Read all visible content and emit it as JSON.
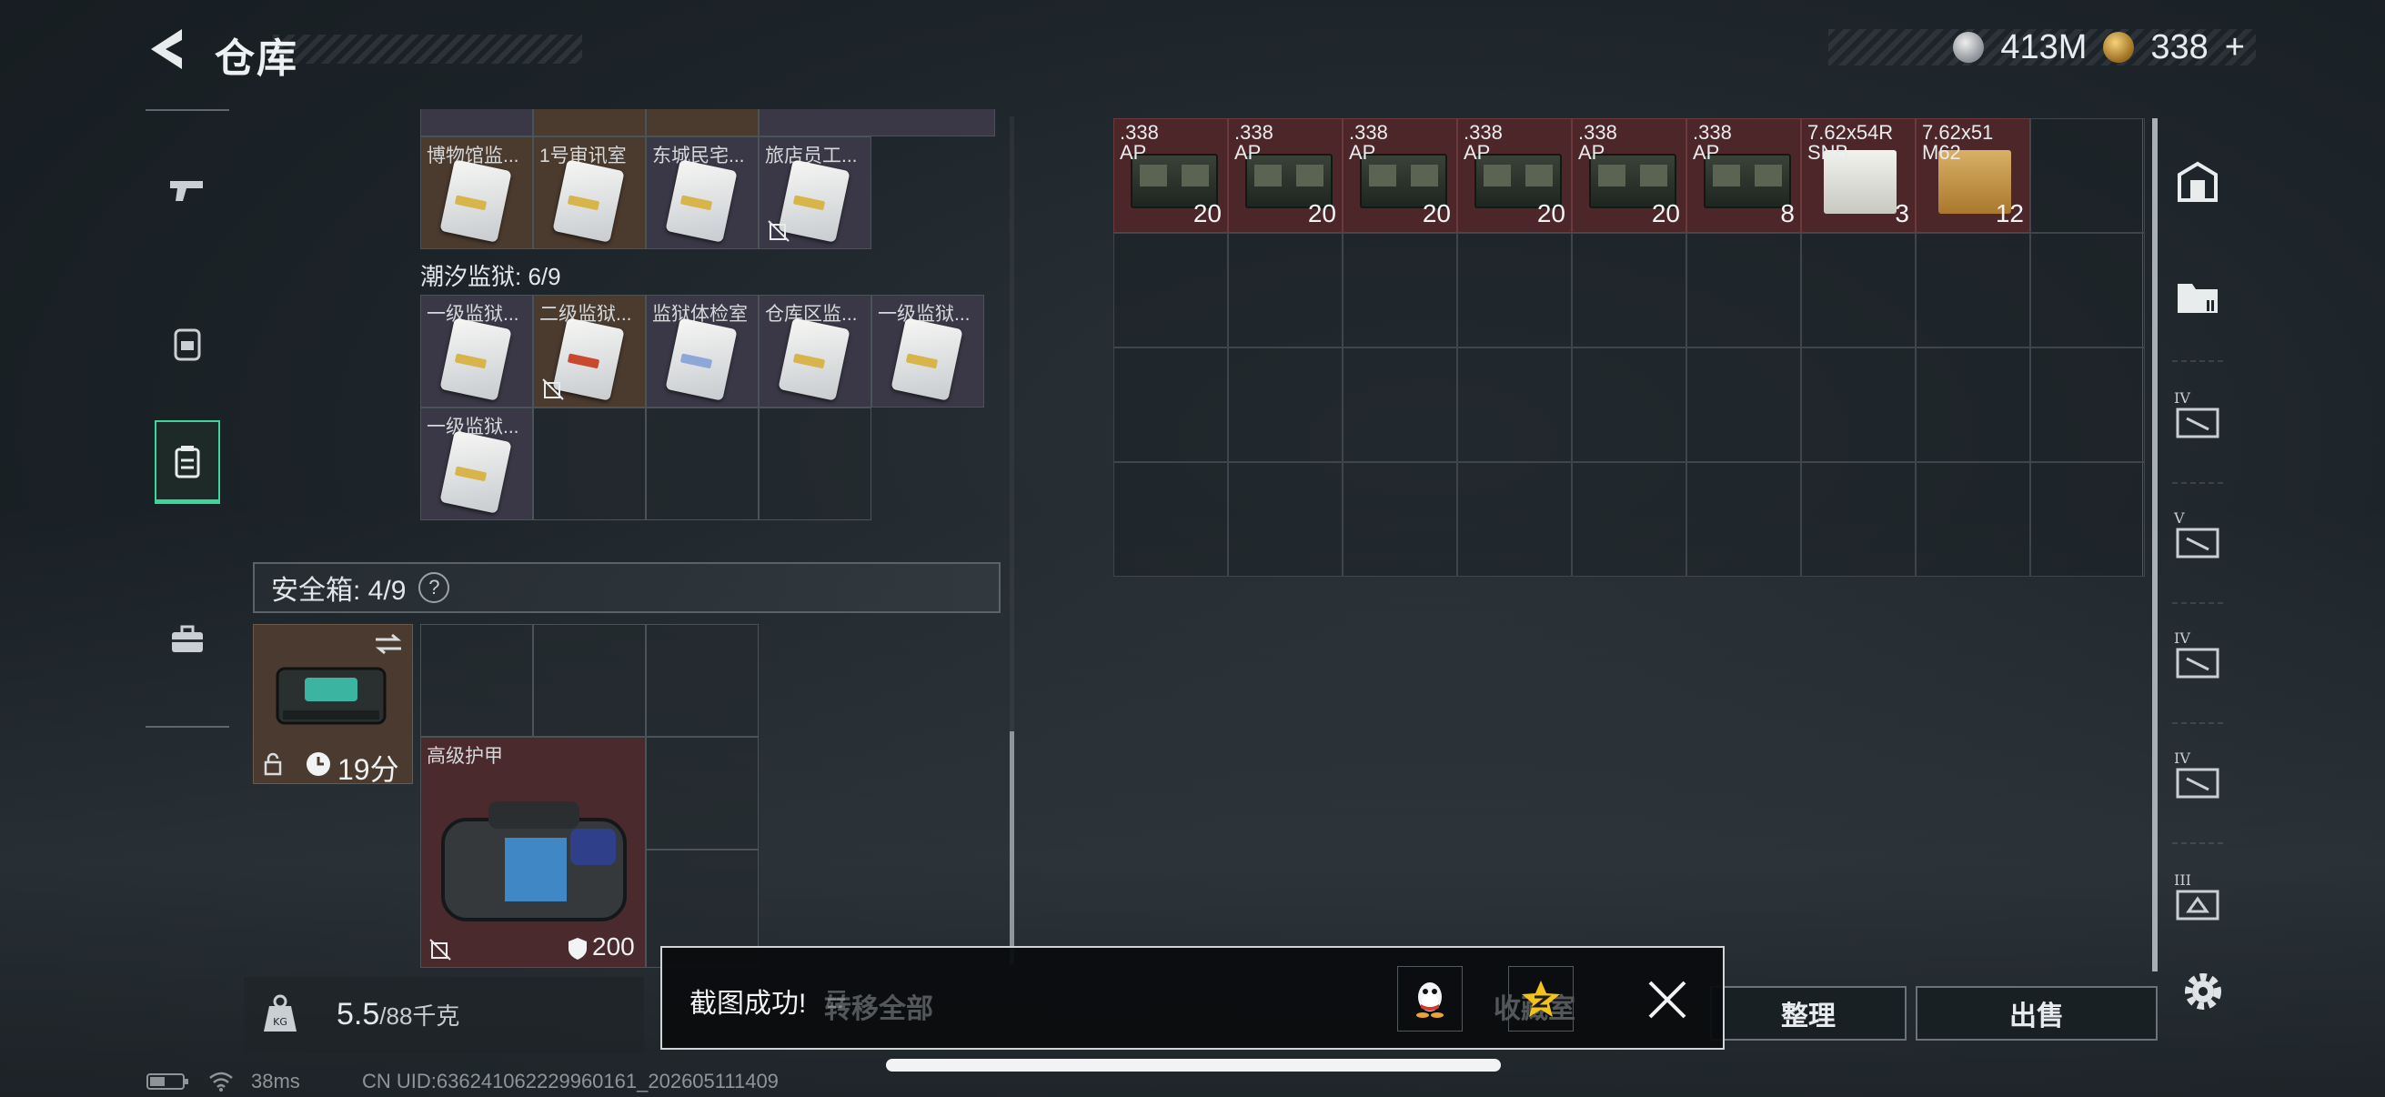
{
  "header": {
    "title": "仓库"
  },
  "currency": [
    {
      "icon": "silver-coin-icon",
      "value": "413M"
    },
    {
      "icon": "gold-coin-icon",
      "value": "338",
      "suffix": "+"
    }
  ],
  "inventory": {
    "row0": [
      {
        "label": "博物馆监...",
        "tint": "white"
      },
      {
        "label": "1号审讯室",
        "tint": "white"
      },
      {
        "label": "东城民宅...",
        "tint": "white"
      },
      {
        "label": "旅店员工...",
        "tint": "white"
      }
    ],
    "prison_label": "潮汐监狱: 6/9",
    "prison_row": [
      {
        "label": "一级监狱...",
        "tint": "gold"
      },
      {
        "label": "二级监狱...",
        "tint": "red"
      },
      {
        "label": "监狱体检室",
        "tint": "blue"
      },
      {
        "label": "仓库区监...",
        "tint": "white"
      },
      {
        "label": "一级监狱...",
        "tint": "gold"
      }
    ],
    "prison_row2": [
      {
        "label": "一级监狱...",
        "tint": "gold"
      }
    ]
  },
  "safebox": {
    "label": "安全箱: 4/9",
    "help": "?",
    "timer": "19分",
    "armor_label": "高级护甲",
    "armor_value": "200"
  },
  "weight": {
    "value": "5.5",
    "unit": "/88千克"
  },
  "stash": [
    {
      "label": ".338\nAP",
      "count": "20",
      "type": "ammo"
    },
    {
      "label": ".338\nAP",
      "count": "20",
      "type": "ammo"
    },
    {
      "label": ".338\nAP",
      "count": "20",
      "type": "ammo"
    },
    {
      "label": ".338\nAP",
      "count": "20",
      "type": "ammo"
    },
    {
      "label": ".338\nAP",
      "count": "20",
      "type": "ammo"
    },
    {
      "label": ".338\nAP",
      "count": "8",
      "type": "ammo"
    },
    {
      "label": "7.62x54R\nSNB",
      "count": "3",
      "type": "white"
    },
    {
      "label": "7.62x51\nM62",
      "count": "12",
      "type": "yellow"
    }
  ],
  "right_tiers": [
    "IV",
    "V",
    "IV",
    "IV",
    "III"
  ],
  "buttons": {
    "transfer_all": "转移全部",
    "collect": "收藏室",
    "sort": "整理",
    "sell": "出售"
  },
  "toast": {
    "message": "截图成功!"
  },
  "status": {
    "ping": "38ms",
    "uid": "CN UID:636241062229960161_202605111409"
  },
  "colors": {
    "accent_green": "#3bd69a",
    "item_red": "#4d2629"
  }
}
